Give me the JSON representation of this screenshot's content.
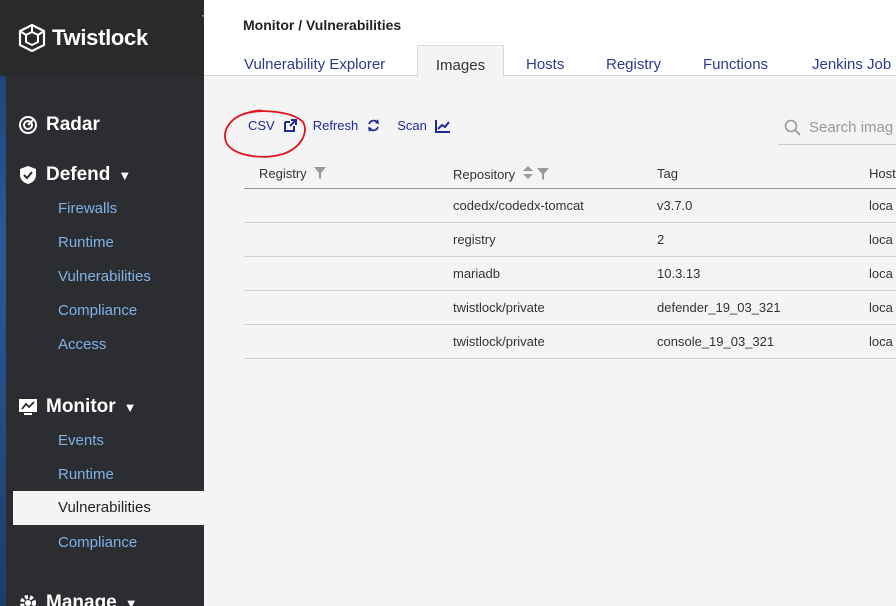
{
  "app": {
    "name": "Twistlock"
  },
  "sidebar": {
    "sections": [
      {
        "label": "Radar",
        "icon": "radar-icon"
      },
      {
        "label": "Defend",
        "icon": "shield-icon",
        "items": [
          "Firewalls",
          "Runtime",
          "Vulnerabilities",
          "Compliance",
          "Access"
        ]
      },
      {
        "label": "Monitor",
        "icon": "monitor-icon",
        "items": [
          "Events",
          "Runtime",
          "Vulnerabilities",
          "Compliance"
        ],
        "active_item": "Vulnerabilities"
      },
      {
        "label": "Manage",
        "icon": "gear-icon"
      }
    ]
  },
  "header": {
    "breadcrumb": "Monitor / Vulnerabilities"
  },
  "tabs": [
    "Vulnerability Explorer",
    "Images",
    "Hosts",
    "Registry",
    "Functions",
    "Jenkins Job"
  ],
  "active_tab": "Images",
  "toolbar": {
    "csv": "CSV",
    "refresh": "Refresh",
    "scan": "Scan"
  },
  "search": {
    "placeholder": "Search imag"
  },
  "table": {
    "headers": [
      "Registry",
      "Repository",
      "Tag",
      "Host"
    ],
    "rows": [
      [
        "",
        "codedx/codedx-tomcat",
        "v3.7.0",
        "loca"
      ],
      [
        "",
        "registry",
        "2",
        "loca"
      ],
      [
        "",
        "mariadb",
        "10.3.13",
        "loca"
      ],
      [
        "",
        "twistlock/private",
        "defender_19_03_321",
        "loca"
      ],
      [
        "",
        "twistlock/private",
        "console_19_03_321",
        "loca"
      ]
    ]
  },
  "colors": {
    "sidebar": "#2c2d30",
    "link": "#7fb3e8",
    "accent": "#1f2a9a",
    "annotation": "#e0141e"
  }
}
